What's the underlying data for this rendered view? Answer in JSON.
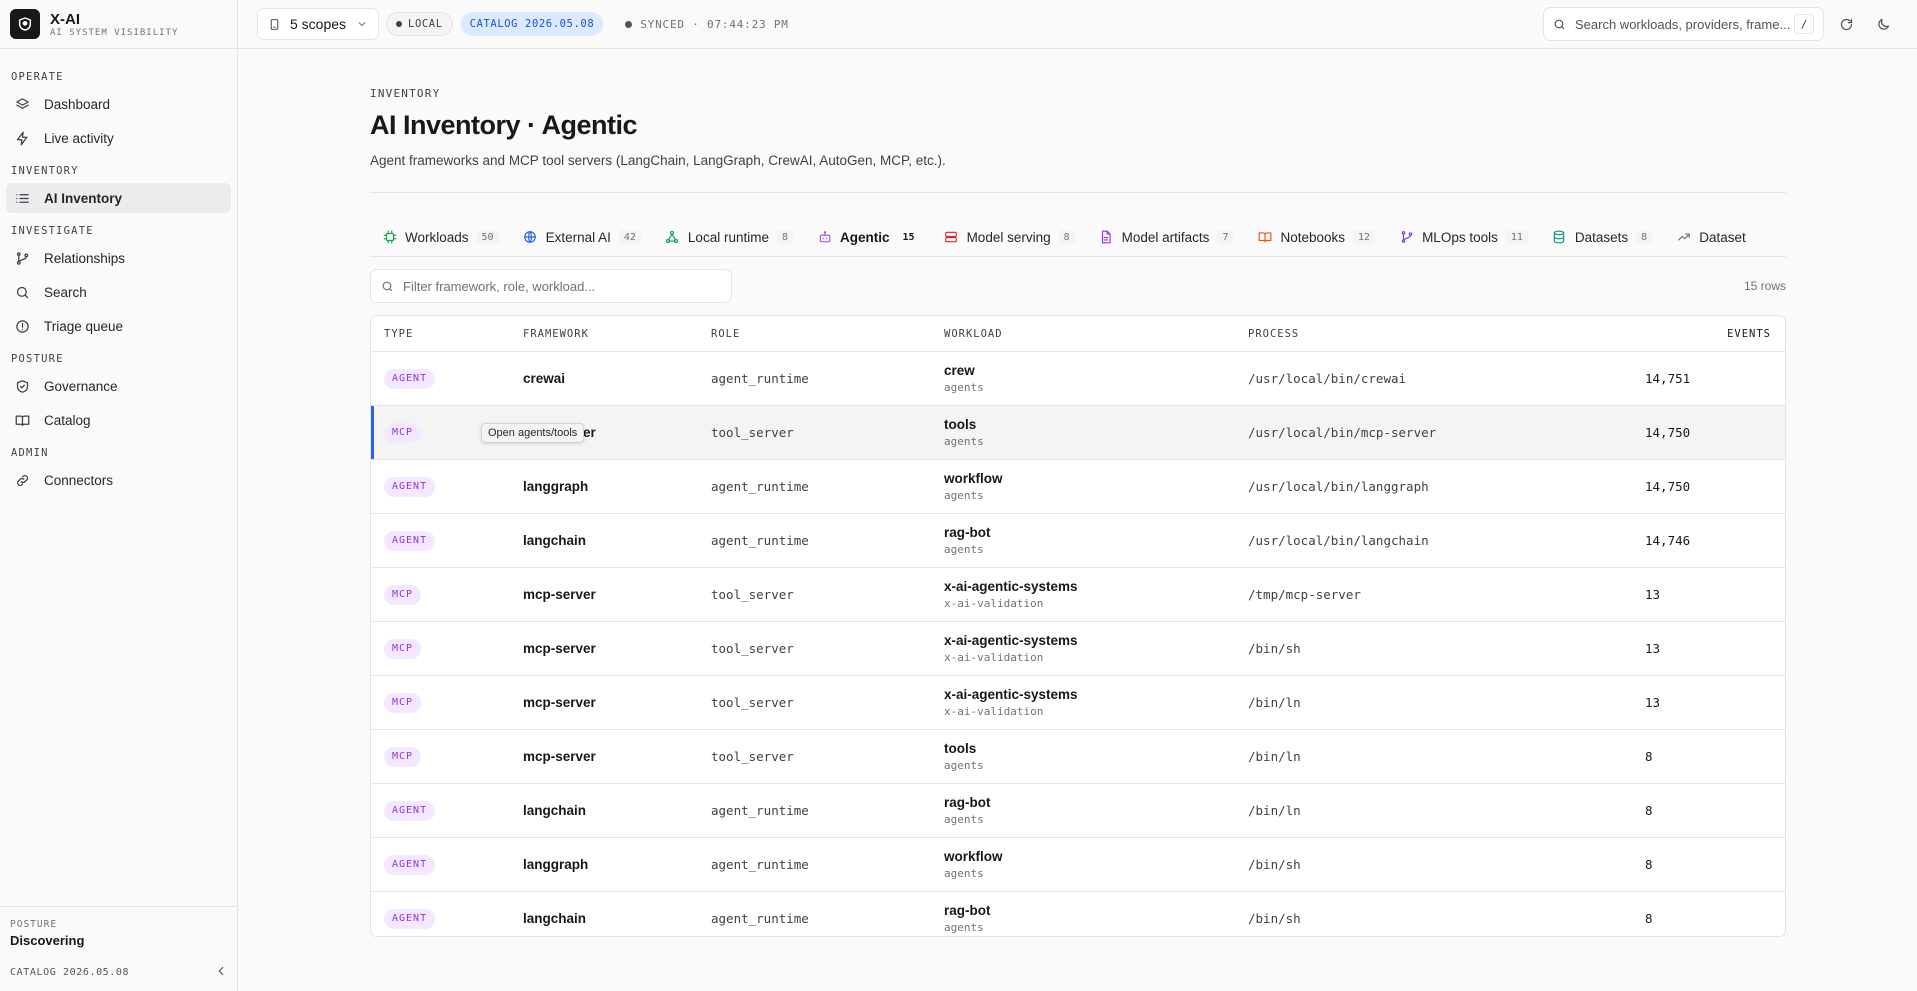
{
  "brand": {
    "name": "X-AI",
    "subtitle": "AI SYSTEM VISIBILITY"
  },
  "sidebar": {
    "sections": [
      {
        "title": "OPERATE",
        "items": [
          {
            "label": "Dashboard",
            "icon": "layers-icon"
          },
          {
            "label": "Live activity",
            "icon": "lightning-icon"
          }
        ]
      },
      {
        "title": "INVENTORY",
        "items": [
          {
            "label": "AI Inventory",
            "icon": "list-icon",
            "active": true
          }
        ]
      },
      {
        "title": "INVESTIGATE",
        "items": [
          {
            "label": "Relationships",
            "icon": "git-branch-icon"
          },
          {
            "label": "Search",
            "icon": "search-icon"
          },
          {
            "label": "Triage queue",
            "icon": "alert-circle-icon"
          }
        ]
      },
      {
        "title": "POSTURE",
        "items": [
          {
            "label": "Governance",
            "icon": "shield-check-icon"
          },
          {
            "label": "Catalog",
            "icon": "book-open-icon"
          }
        ]
      },
      {
        "title": "ADMIN",
        "items": [
          {
            "label": "Connectors",
            "icon": "link-icon"
          }
        ]
      }
    ],
    "footer": {
      "posture_label": "POSTURE",
      "posture_value": "Discovering",
      "catalog": "CATALOG 2026.05.08"
    }
  },
  "topbar": {
    "scopes": "5 scopes",
    "local": "LOCAL",
    "catalog": "CATALOG 2026.05.08",
    "sync": "SYNCED · 07:44:23 PM",
    "search_placeholder": "Search workloads, providers, frame...",
    "search_kbd": "/"
  },
  "page": {
    "eyebrow": "INVENTORY",
    "title": "AI Inventory · Agentic",
    "description": "Agent frameworks and MCP tool servers (LangChain, LangGraph, CrewAI, AutoGen, MCP, etc.)."
  },
  "tabs": [
    {
      "label": "Workloads",
      "count": "50",
      "icon": "cpu-icon"
    },
    {
      "label": "External AI",
      "count": "42",
      "icon": "globe-icon"
    },
    {
      "label": "Local runtime",
      "count": "8",
      "icon": "network-icon"
    },
    {
      "label": "Agentic",
      "count": "15",
      "icon": "bot-icon",
      "active": true
    },
    {
      "label": "Model serving",
      "count": "8",
      "icon": "server-icon"
    },
    {
      "label": "Model artifacts",
      "count": "7",
      "icon": "file-icon"
    },
    {
      "label": "Notebooks",
      "count": "12",
      "icon": "book-icon"
    },
    {
      "label": "MLOps tools",
      "count": "11",
      "icon": "git-icon"
    },
    {
      "label": "Datasets",
      "count": "8",
      "icon": "database-icon"
    },
    {
      "label": "Dataset",
      "count": "",
      "icon": "trending-icon"
    }
  ],
  "filter": {
    "placeholder": "Filter framework, role, workload...",
    "rows": "15 rows"
  },
  "table": {
    "headers": {
      "type": "TYPE",
      "framework": "FRAMEWORK",
      "role": "ROLE",
      "workload": "WORKLOAD",
      "process": "PROCESS",
      "events": "EVENTS"
    },
    "tooltip": "Open agents/tools",
    "rows": [
      {
        "type": "AGENT",
        "framework": "crewai",
        "role": "agent_runtime",
        "workload": "crew",
        "namespace": "agents",
        "process": "/usr/local/bin/crewai",
        "events": "14,751"
      },
      {
        "type": "MCP",
        "framework": "mcp-server",
        "role": "tool_server",
        "workload": "tools",
        "namespace": "agents",
        "process": "/usr/local/bin/mcp-server",
        "events": "14,750",
        "selected": true
      },
      {
        "type": "AGENT",
        "framework": "langgraph",
        "role": "agent_runtime",
        "workload": "workflow",
        "namespace": "agents",
        "process": "/usr/local/bin/langgraph",
        "events": "14,750"
      },
      {
        "type": "AGENT",
        "framework": "langchain",
        "role": "agent_runtime",
        "workload": "rag-bot",
        "namespace": "agents",
        "process": "/usr/local/bin/langchain",
        "events": "14,746"
      },
      {
        "type": "MCP",
        "framework": "mcp-server",
        "role": "tool_server",
        "workload": "x-ai-agentic-systems",
        "namespace": "x-ai-validation",
        "process": "/tmp/mcp-server",
        "events": "13"
      },
      {
        "type": "MCP",
        "framework": "mcp-server",
        "role": "tool_server",
        "workload": "x-ai-agentic-systems",
        "namespace": "x-ai-validation",
        "process": "/bin/sh",
        "events": "13"
      },
      {
        "type": "MCP",
        "framework": "mcp-server",
        "role": "tool_server",
        "workload": "x-ai-agentic-systems",
        "namespace": "x-ai-validation",
        "process": "/bin/ln",
        "events": "13"
      },
      {
        "type": "MCP",
        "framework": "mcp-server",
        "role": "tool_server",
        "workload": "tools",
        "namespace": "agents",
        "process": "/bin/ln",
        "events": "8"
      },
      {
        "type": "AGENT",
        "framework": "langchain",
        "role": "agent_runtime",
        "workload": "rag-bot",
        "namespace": "agents",
        "process": "/bin/ln",
        "events": "8"
      },
      {
        "type": "AGENT",
        "framework": "langgraph",
        "role": "agent_runtime",
        "workload": "workflow",
        "namespace": "agents",
        "process": "/bin/sh",
        "events": "8"
      },
      {
        "type": "AGENT",
        "framework": "langchain",
        "role": "agent_runtime",
        "workload": "rag-bot",
        "namespace": "agents",
        "process": "/bin/sh",
        "events": "8"
      }
    ]
  }
}
